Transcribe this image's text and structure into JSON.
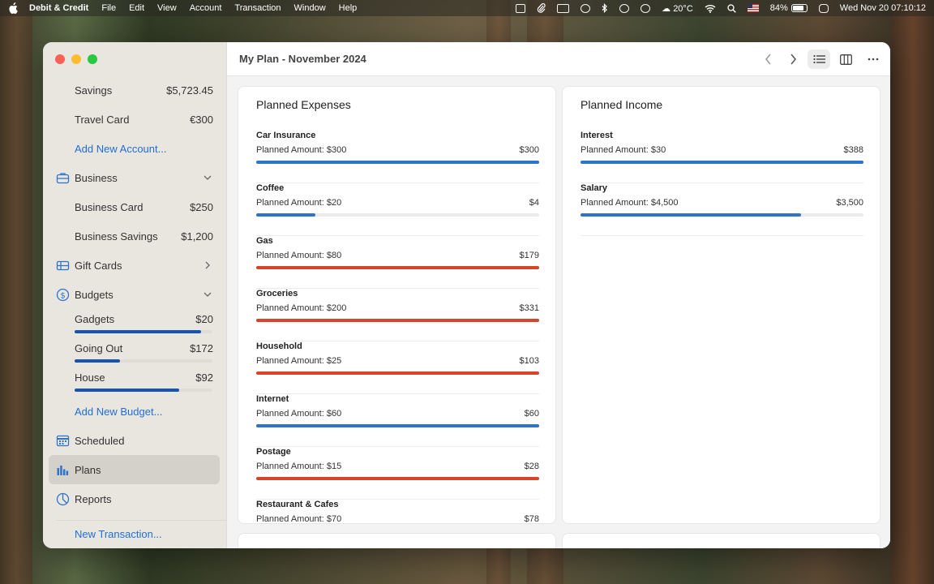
{
  "menubar": {
    "app_name": "Debit & Credit",
    "menus": [
      "File",
      "Edit",
      "View",
      "Account",
      "Transaction",
      "Window",
      "Help"
    ],
    "weather": "20°C",
    "battery": "84%",
    "clock": "Wed Nov 20  07:10:12"
  },
  "sidebar": {
    "accounts": [
      {
        "label": "Savings",
        "value": "$5,723.45"
      },
      {
        "label": "Travel Card",
        "value": "€300"
      }
    ],
    "add_account": "Add New Account...",
    "business": {
      "label": "Business",
      "items": [
        {
          "label": "Business Card",
          "value": "$250"
        },
        {
          "label": "Business Savings",
          "value": "$1,200"
        }
      ]
    },
    "gift_cards": "Gift Cards",
    "budgets": {
      "label": "Budgets",
      "items": [
        {
          "label": "Gadgets",
          "value": "$20",
          "fill": 0.92
        },
        {
          "label": "Going Out",
          "value": "$172",
          "fill": 0.33
        },
        {
          "label": "House",
          "value": "$92",
          "fill": 0.76
        }
      ]
    },
    "add_budget": "Add New Budget...",
    "scheduled": "Scheduled",
    "plans": "Plans",
    "reports": "Reports",
    "new_transaction": "New Transaction..."
  },
  "toolbar": {
    "title": "My Plan - November 2024"
  },
  "planned_expenses": {
    "title": "Planned Expenses",
    "items": [
      {
        "name": "Car Insurance",
        "planned": "Planned Amount: $300",
        "actual": "$300",
        "fill": 1.0,
        "over": false
      },
      {
        "name": "Coffee",
        "planned": "Planned Amount: $20",
        "actual": "$4",
        "fill": 0.21,
        "over": false
      },
      {
        "name": "Gas",
        "planned": "Planned Amount: $80",
        "actual": "$179",
        "fill": 1.0,
        "over": true
      },
      {
        "name": "Groceries",
        "planned": "Planned Amount: $200",
        "actual": "$331",
        "fill": 1.0,
        "over": true
      },
      {
        "name": "Household",
        "planned": "Planned Amount: $25",
        "actual": "$103",
        "fill": 1.0,
        "over": true
      },
      {
        "name": "Internet",
        "planned": "Planned Amount: $60",
        "actual": "$60",
        "fill": 1.0,
        "over": false
      },
      {
        "name": "Postage",
        "planned": "Planned Amount: $15",
        "actual": "$28",
        "fill": 1.0,
        "over": true
      },
      {
        "name": "Restaurant & Cafes",
        "planned": "Planned Amount: $70",
        "actual": "$78",
        "fill": 1.0,
        "over": true
      }
    ]
  },
  "planned_income": {
    "title": "Planned Income",
    "items": [
      {
        "name": "Interest",
        "planned": "Planned Amount: $30",
        "actual": "$388",
        "fill": 1.0,
        "over": false
      },
      {
        "name": "Salary",
        "planned": "Planned Amount: $4,500",
        "actual": "$3,500",
        "fill": 0.78,
        "over": false
      }
    ]
  },
  "colors": {
    "bar_ok": "#2f74c9",
    "bar_over": "#d5442b",
    "budget_bar": "#1553b5",
    "link": "#1f6fd6"
  }
}
